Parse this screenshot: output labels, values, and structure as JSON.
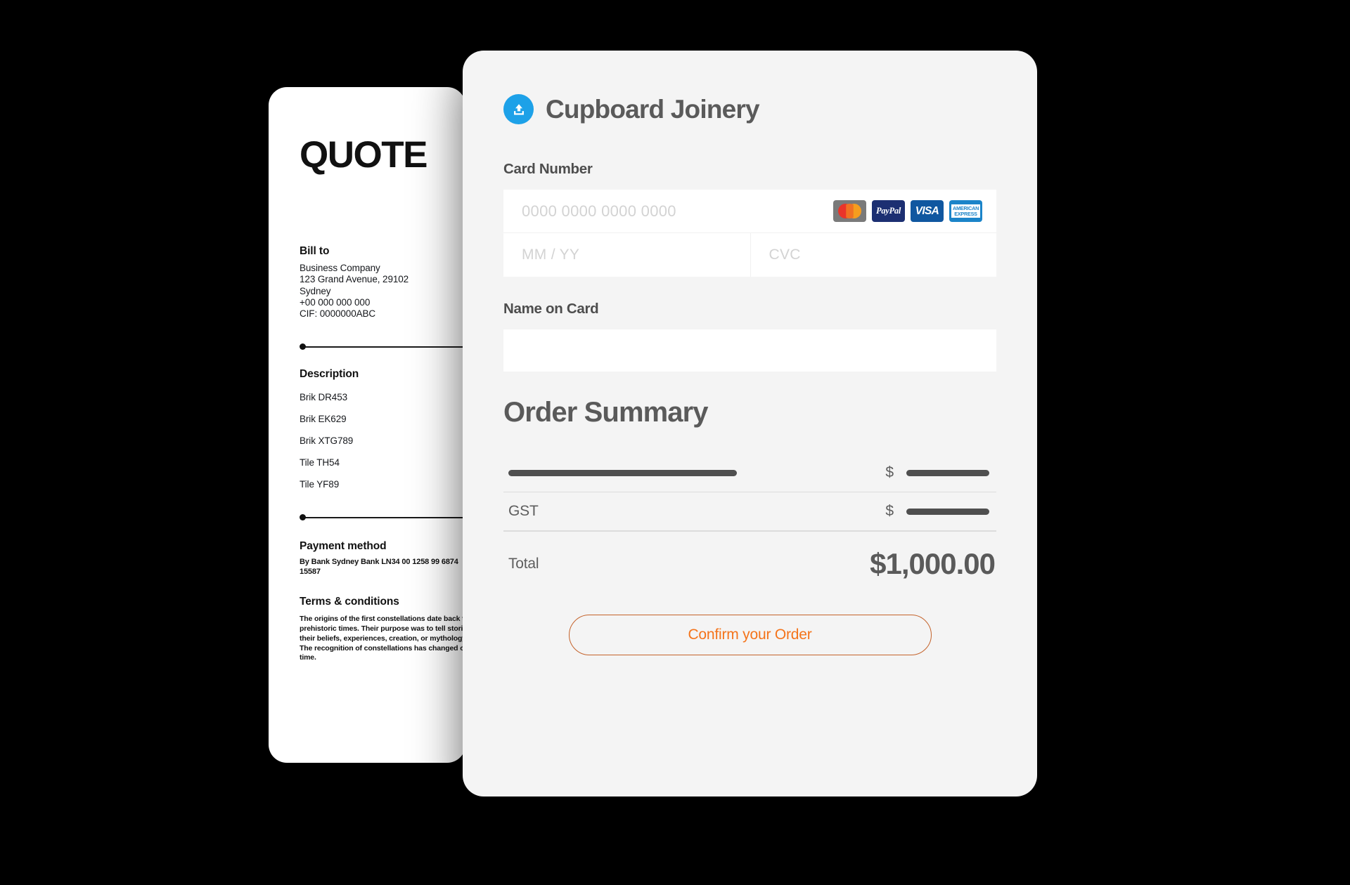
{
  "theme": {
    "background": "#000000",
    "quote_card_bg": "#ffffff",
    "payment_card_bg": "#f4f4f4",
    "brand_blue": "#1da1e8",
    "accent_orange": "#f4741b",
    "accent_orange_border": "#c4622a",
    "text_gray": "#5a5a5a",
    "placeholder_gray": "#d3d3d3"
  },
  "quote": {
    "title": "QUOTE",
    "bill_to": {
      "heading": "Bill to",
      "lines": [
        "Business Company",
        "123 Grand Avenue, 29102",
        "Sydney",
        "+00 000 000 000",
        "CIF: 0000000ABC"
      ]
    },
    "description": {
      "heading": "Description",
      "items": [
        "Brik DR453",
        "Brik EK629",
        "Brik XTG789",
        "Tile TH54",
        "Tile YF89"
      ]
    },
    "payment_method": {
      "heading": "Payment method",
      "text": "By Bank Sydney Bank LN34 00 1258 99 6874 15587"
    },
    "terms": {
      "heading": "Terms & conditions",
      "text": "The origins of the first constellations date back to prehistoric times. Their purpose was to tell stories of their beliefs, experiences, creation, or mythology. The recognition of constellations has changed over time."
    }
  },
  "payment": {
    "brand_name": "Cupboard Joinery",
    "logo_icon": "upload-circle-icon",
    "card_number": {
      "label": "Card Number",
      "placeholder": "0000 0000 0000 0000",
      "value": ""
    },
    "expiry": {
      "placeholder": "MM / YY",
      "value": ""
    },
    "cvc": {
      "placeholder": "CVC",
      "value": ""
    },
    "name_on_card": {
      "label": "Name on Card",
      "placeholder": "",
      "value": ""
    },
    "card_brands": [
      {
        "id": "mastercard-icon",
        "label": ""
      },
      {
        "id": "paypal-icon",
        "label": "PayPal"
      },
      {
        "id": "visa-icon",
        "label": "VISA"
      },
      {
        "id": "amex-icon",
        "label_line1": "AMERICAN",
        "label_line2": "EXPRESS"
      }
    ],
    "order_summary": {
      "title": "Order Summary",
      "rows": [
        {
          "label": "",
          "currency": "$",
          "amount": ""
        },
        {
          "label": "GST",
          "currency": "$",
          "amount": ""
        }
      ],
      "total_label": "Total",
      "total_value": "$1,000.00"
    },
    "confirm_button": "Confirm your Order"
  }
}
